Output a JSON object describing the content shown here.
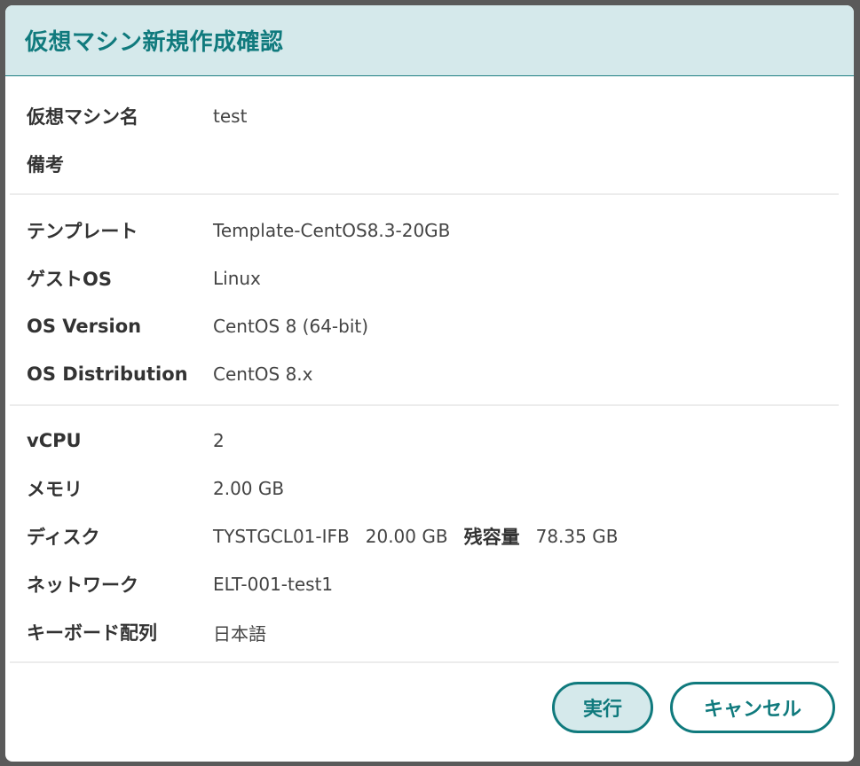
{
  "dialog": {
    "title": "仮想マシン新規作成確認"
  },
  "basic": {
    "vm_name_label": "仮想マシン名",
    "vm_name_value": "test",
    "note_label": "備考",
    "note_value": ""
  },
  "template": {
    "template_label": "テンプレート",
    "template_value": "Template-CentOS8.3-20GB",
    "guest_os_label": "ゲストOS",
    "guest_os_value": "Linux",
    "os_version_label": "OS Version",
    "os_version_value": "CentOS 8 (64-bit)",
    "os_distribution_label": "OS Distribution",
    "os_distribution_value": "CentOS 8.x"
  },
  "resources": {
    "vcpu_label": "vCPU",
    "vcpu_value": "2",
    "memory_label": "メモリ",
    "memory_value": "2.00 GB",
    "disk_label": "ディスク",
    "disk_name": "TYSTGCL01-IFB",
    "disk_size": "20.00 GB",
    "remaining_label": "残容量",
    "remaining_value": "78.35 GB",
    "network_label": "ネットワーク",
    "network_value": "ELT-001-test1",
    "keyboard_label": "キーボード配列",
    "keyboard_value": "日本語"
  },
  "buttons": {
    "execute_label": "実行",
    "cancel_label": "キャンセル"
  },
  "colors": {
    "accent": "#107a7d",
    "header_bg": "#d5e9eb"
  }
}
